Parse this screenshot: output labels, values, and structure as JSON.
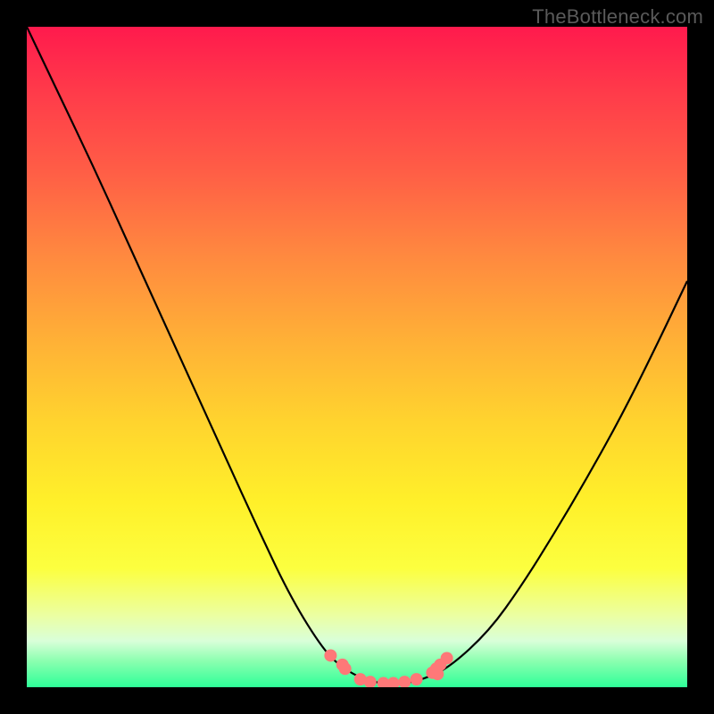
{
  "attribution": "TheBottleneck.com",
  "background": {
    "frame_color": "#000000",
    "gradient_stops": [
      {
        "offset": 0.0,
        "color": "#ff1a4d"
      },
      {
        "offset": 0.1,
        "color": "#ff3b4a"
      },
      {
        "offset": 0.22,
        "color": "#ff5e46"
      },
      {
        "offset": 0.35,
        "color": "#ff8a3f"
      },
      {
        "offset": 0.48,
        "color": "#ffb236"
      },
      {
        "offset": 0.6,
        "color": "#ffd42e"
      },
      {
        "offset": 0.72,
        "color": "#fff02a"
      },
      {
        "offset": 0.82,
        "color": "#fcff3f"
      },
      {
        "offset": 0.89,
        "color": "#ecffa0"
      },
      {
        "offset": 0.93,
        "color": "#d9ffd9"
      },
      {
        "offset": 0.96,
        "color": "#8cffb0"
      },
      {
        "offset": 1.0,
        "color": "#2eff98"
      }
    ]
  },
  "chart_data": {
    "type": "line",
    "title": "",
    "xlabel": "",
    "ylabel": "",
    "xlim": [
      0,
      1
    ],
    "ylim": [
      0,
      1
    ],
    "grid": false,
    "curve_stroke": "#000000",
    "dot_fill": "#fe7878",
    "series": [
      {
        "name": "bottleneck-curve",
        "x": [
          0.0,
          0.05,
          0.1,
          0.15,
          0.2,
          0.25,
          0.3,
          0.35,
          0.4,
          0.45,
          0.48,
          0.51,
          0.54,
          0.57,
          0.6,
          0.64,
          0.7,
          0.75,
          0.8,
          0.85,
          0.9,
          0.95,
          1.0
        ],
        "y": [
          1.0,
          0.895,
          0.79,
          0.68,
          0.57,
          0.46,
          0.35,
          0.24,
          0.135,
          0.055,
          0.028,
          0.012,
          0.005,
          0.005,
          0.012,
          0.03,
          0.085,
          0.155,
          0.235,
          0.32,
          0.41,
          0.51,
          0.615
        ]
      }
    ],
    "dots": [
      {
        "x": 0.46,
        "y": 0.048
      },
      {
        "x": 0.478,
        "y": 0.034
      },
      {
        "x": 0.482,
        "y": 0.028
      },
      {
        "x": 0.505,
        "y": 0.012
      },
      {
        "x": 0.52,
        "y": 0.008
      },
      {
        "x": 0.54,
        "y": 0.006
      },
      {
        "x": 0.555,
        "y": 0.006
      },
      {
        "x": 0.572,
        "y": 0.008
      },
      {
        "x": 0.59,
        "y": 0.012
      },
      {
        "x": 0.614,
        "y": 0.022
      },
      {
        "x": 0.62,
        "y": 0.028
      },
      {
        "x": 0.626,
        "y": 0.034
      },
      {
        "x": 0.636,
        "y": 0.044
      },
      {
        "x": 0.622,
        "y": 0.02
      }
    ]
  }
}
